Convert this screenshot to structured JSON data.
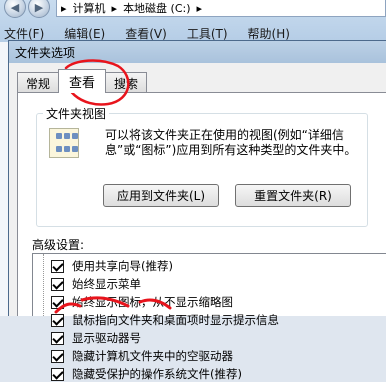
{
  "explorer": {
    "address": [
      "计算机",
      "本地磁盘 (C:)"
    ],
    "menu": [
      "文件(F)",
      "编辑(E)",
      "查看(V)",
      "工具(T)",
      "帮助(H)"
    ]
  },
  "dialog": {
    "title": "文件夹选项",
    "tabs": [
      "常规",
      "查看",
      "搜索"
    ],
    "folder_views": {
      "legend": "文件夹视图",
      "description": "可以将该文件夹正在使用的视图(例如“详细信息”或“图标”)应用到所有这种类型的文件夹中。",
      "apply_button": "应用到文件夹(L)",
      "reset_button": "重置文件夹(R)"
    },
    "advanced_label": "高级设置:",
    "advanced_items": [
      {
        "label": "使用共享向导(推荐)",
        "checked": true
      },
      {
        "label": "始终显示菜单",
        "checked": true
      },
      {
        "label": "始终显示图标，从不显示缩略图",
        "checked": true
      },
      {
        "label": "鼠标指向文件夹和桌面项时显示提示信息",
        "checked": true
      },
      {
        "label": "显示驱动器号",
        "checked": true
      },
      {
        "label": "隐藏计算机文件夹中的空驱动器",
        "checked": true
      },
      {
        "label": "隐藏受保护的操作系统文件(推荐)",
        "checked": true
      }
    ],
    "annotation_color": "#e8141c"
  }
}
